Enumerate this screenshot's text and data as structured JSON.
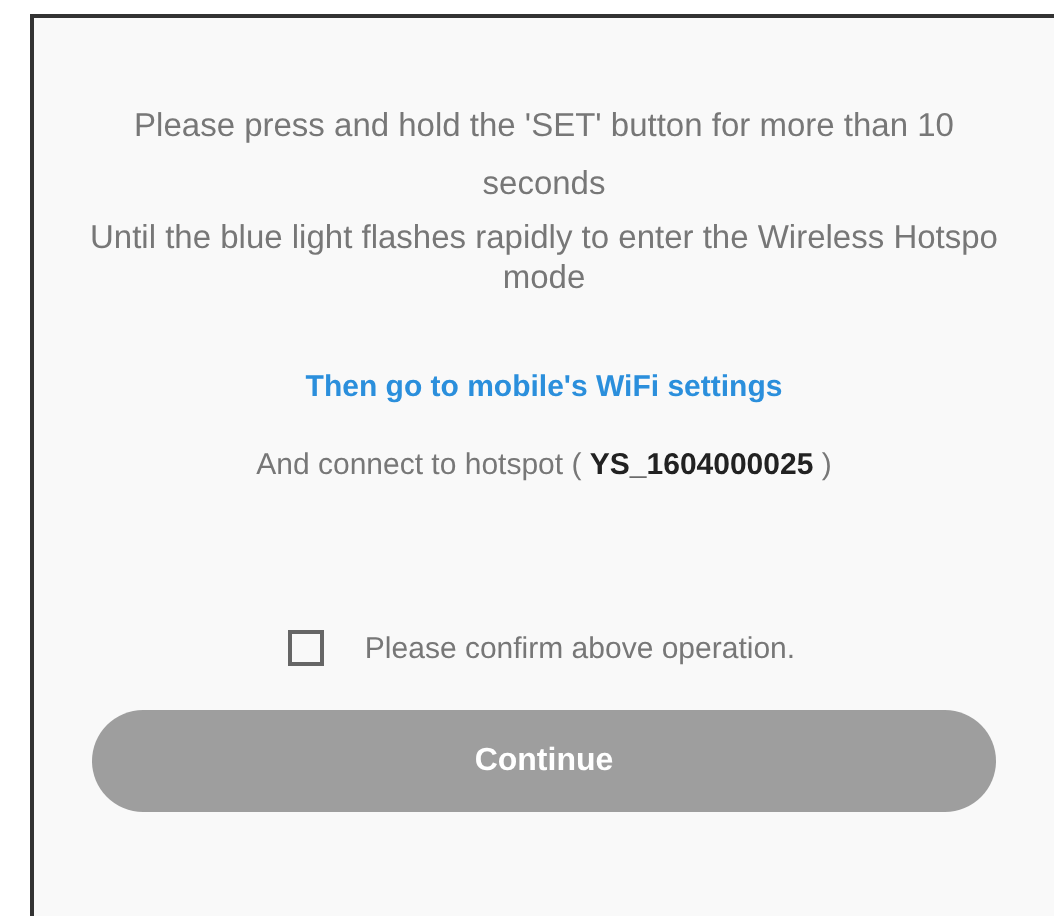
{
  "instructions": [
    {
      "text": "Please press and hold the 'SET' button for more than 10 seconds",
      "kind": "wide"
    },
    {
      "text": "Until the blue light flashes rapidly to enter the Wireless Hotspo mode",
      "kind": "tight"
    }
  ],
  "wifi_link": "Then go to mobile's WiFi settings",
  "connect_text": "And connect to hotspot ( **YS_1604000025** )",
  "confirm": {
    "label": "Please confirm above operation.",
    "checked": false
  },
  "continue_button": {
    "label": "Continue",
    "disabled": true
  }
}
